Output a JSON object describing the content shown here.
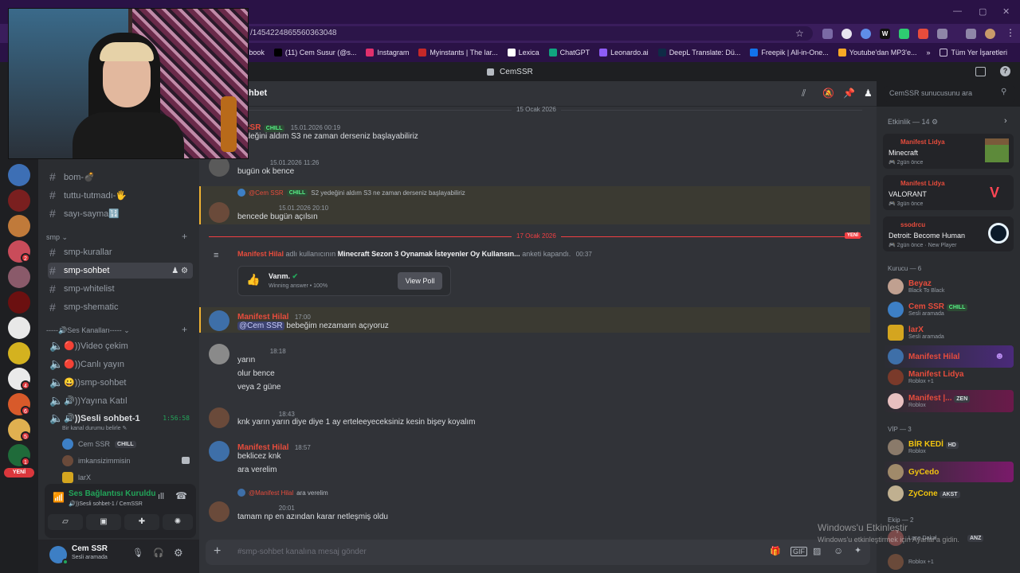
{
  "browser": {
    "url": "/1454224865560363048",
    "bookmarks": [
      {
        "label": "book",
        "color": "#4267b2"
      },
      {
        "label": "(11) Cem Susur (@s...",
        "color": "#000000"
      },
      {
        "label": "Instagram",
        "color": "#e1306c"
      },
      {
        "label": "Myinstants | The lar...",
        "color": "#c62828"
      },
      {
        "label": "Lexica",
        "color": "#ffffff"
      },
      {
        "label": "ChatGPT",
        "color": "#10a37f"
      },
      {
        "label": "Leonardo.ai",
        "color": "#8e5cf7"
      },
      {
        "label": "DeepL Translate: Dü...",
        "color": "#0f2b46"
      },
      {
        "label": "Freepik | All-in-One...",
        "color": "#1273eb"
      },
      {
        "label": "Youtube'dan MP3'e...",
        "color": "#f9a825"
      }
    ],
    "more_bookmarks": "»",
    "all_bookmarks": "Tüm Yer İşaretleri"
  },
  "discord": {
    "server_title": "CemSSR",
    "channel_header": "hbet",
    "search_placeholder": "CemSSR sunucusunu ara",
    "channels_top": [
      {
        "name": "bom-💣"
      },
      {
        "name": "tuttu-tutmadı-🖐"
      },
      {
        "name": "sayı-sayma🔢"
      }
    ],
    "smp_category": "smp",
    "smp_channels": [
      {
        "name": "smp-kurallar"
      },
      {
        "name": "smp-sohbet"
      },
      {
        "name": "smp-whitelist"
      },
      {
        "name": "smp-shematic"
      }
    ],
    "voice_category": "-----🔊Ses Kanalları-----",
    "voice_channels": [
      {
        "name": "🔴))Video çekim"
      },
      {
        "name": "🔴))Canlı yayın"
      },
      {
        "name": "😀))smp-sohbet"
      },
      {
        "name": "🔊))Yayına Katıl"
      },
      {
        "name": "🔊))Sesli sohbet-1"
      }
    ],
    "voice_timer": "1:56:58",
    "voice_status": "Bir kanal durumu belirle",
    "voice_users": [
      {
        "name": "Cem SSR",
        "tag": "CHILL"
      },
      {
        "name": "imkansizimmisin",
        "tag": ""
      },
      {
        "name": "larX",
        "tag": ""
      }
    ],
    "new_badge": "YENİ",
    "connection_title": "Ses Bağlantısı Kuruldu",
    "connection_sub": "🔊))Sesli sohbet-1 / CemSSR",
    "user_name": "Cem SSR",
    "user_status": "Sesli aramada",
    "server_badges": [
      "2",
      "4",
      "6",
      "5",
      "1"
    ],
    "composer_placeholder": "#smp-sohbet kanalına mesaj gönder",
    "messages": {
      "date1": "15 Ocak 2026",
      "m1_name": "n SSR",
      "m1_tag": "CHILL",
      "m1_time": "15.01.2026 00:19",
      "m1_text": "yedeğini aldım S3 ne zaman derseniz başlayabiliriz",
      "m2_time": "15.01.2026 11:26",
      "m2_text": "bugün ok bence",
      "m3_reply_name": "@Cem SSR",
      "m3_reply_tag": "CHILL",
      "m3_reply_text": "S2 yedeğini aldım S3 ne zaman derseniz başlayabiliriz",
      "m3_time": "15.01.2026 20:10",
      "m3_text": "bencede bugün açılsın",
      "date2": "17 Ocak 2026",
      "date2_badge": "YENİ",
      "poll_user": "Manifest Hilal",
      "poll_mid": "adlı kullanıcının",
      "poll_title": "Minecraft Sezon 3 Oynamak İsteyenler Oy Kullansın...",
      "poll_end": "anketi kapandı.",
      "poll_time": "00:37",
      "poll_answer": "Varım.",
      "poll_winning": "Winning answer • 100%",
      "poll_button": "View Poll",
      "m4_name": "Manifest Hilal",
      "m4_time": "17:00",
      "m4_mention": "@Cem SSR",
      "m4_text": "bebeğim nezamann açıyoruz",
      "m5_time": "18:18",
      "m5_lines": [
        "yarın",
        "olur bence",
        "veya 2 güne"
      ],
      "m6_time": "18:43",
      "m6_text": "knk yarın yarın diye diye 1 ay erteleeyeceksiniz kesin bişey koyalım",
      "m7_name": "Manifest Hilal",
      "m7_time": "18:57",
      "m7_lines": [
        "beklicez knk",
        "ara verelim"
      ],
      "m8_reply_name": "@Manifest Hilal",
      "m8_reply_text": "ara verelim",
      "m8_time": "20:01",
      "m8_text": "tamam np en azından karar netleşmiş oldu"
    },
    "activity": {
      "title": "Etkinlik — 14",
      "cards": [
        {
          "user": "Manifest Lidya",
          "game": "Minecraft",
          "time": "2gün önce",
          "extra": ""
        },
        {
          "user": "Manifest Lidya",
          "game": "VALORANT",
          "time": "3gün önce",
          "extra": ""
        },
        {
          "user": "ssodrcu",
          "game": "Detroit: Become Human",
          "time": "2gün önce",
          "extra": "New Player"
        }
      ]
    },
    "groups": {
      "kurucu": "Kurucu — 6",
      "vip": "VİP — 3",
      "ekip": "Ekip — 2"
    },
    "members": [
      {
        "name": "Beyaz",
        "sub": "Black To Black",
        "color": "#e74c3c",
        "tag": ""
      },
      {
        "name": "Cem SSR",
        "sub": "Sesli aramada",
        "color": "#e74c3c",
        "tag": "CHILL"
      },
      {
        "name": "larX",
        "sub": "Sesli aramada",
        "color": "#e74c3c",
        "tag": ""
      },
      {
        "name": "Manifest Hilal",
        "sub": "",
        "color": "#e74c3c",
        "tag": ""
      },
      {
        "name": "Manifest Lidya",
        "sub": "Roblox +1",
        "color": "#e74c3c",
        "tag": ""
      },
      {
        "name": "Manifest |...",
        "sub": "Roblox",
        "color": "#e74c3c",
        "tag": "ZEN"
      },
      {
        "name": "BİR KEDİ",
        "sub": "Roblox",
        "color": "#f1c40f",
        "tag": "HD"
      },
      {
        "name": "GyCedo",
        "sub": "",
        "color": "#f1c40f",
        "tag": ""
      },
      {
        "name": "ZyCone",
        "sub": "",
        "color": "#f1c40f",
        "tag": "AKST"
      },
      {
        "name": "",
        "sub": "Roblox +1",
        "color": "#e74c3c",
        "tag": "ANZ"
      }
    ],
    "ekip_member_sub": "Lane Dakal"
  },
  "watermark": {
    "line1": "Windows'u Etkinleştir",
    "line2": "Windows'u etkinleştirmek için Ayarlar'a gidin."
  }
}
